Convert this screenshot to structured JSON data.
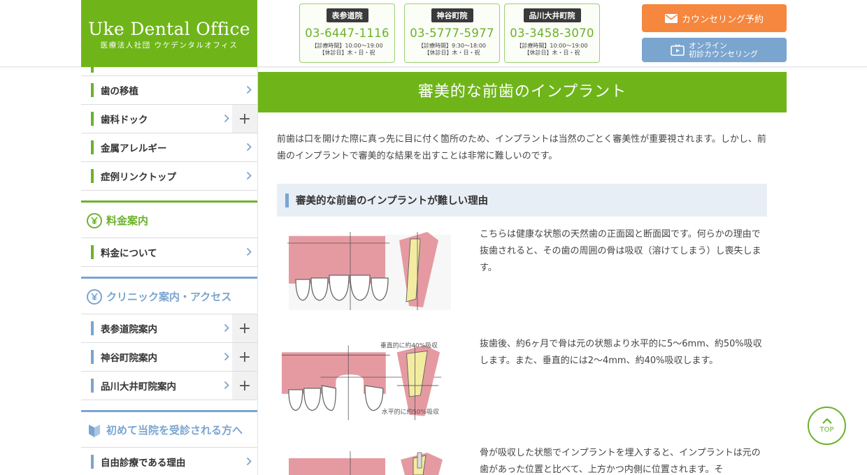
{
  "header": {
    "logo_title": "Uke Dental Office",
    "logo_subtitle": "医療法人社団 ウケデンタルオフィス",
    "clinics": [
      {
        "name": "表参道院",
        "tel": "03-6447-1116",
        "hours": "【診療時間】10:00〜19:00",
        "closed": "【休診日】木・日・祝"
      },
      {
        "name": "神谷町院",
        "tel": "03-5777-5977",
        "hours": "【診療時間】9:30〜18:00",
        "closed": "【休診日】木・日・祝"
      },
      {
        "name": "品川大井町院",
        "tel": "03-3458-3070",
        "hours": "【診療時間】10:00〜19:00",
        "closed": "【休診日】木・日・祝"
      }
    ],
    "counseling_button": "カウンセリング予約",
    "online_button": "オンライン\n初診カウンセリング"
  },
  "sidebar": {
    "items_top": [
      {
        "label": "歯の移植",
        "plus": false
      },
      {
        "label": "歯科ドック",
        "plus": true
      },
      {
        "label": "金属アレルギー",
        "plus": false
      },
      {
        "label": "症例リンクトップ",
        "plus": false
      }
    ],
    "fee_section": {
      "title": "料金案内",
      "items": [
        {
          "label": "料金について"
        }
      ]
    },
    "clinic_section": {
      "title": "クリニック案内・アクセス",
      "items": [
        {
          "label": "表参道院案内"
        },
        {
          "label": "神谷町院案内"
        },
        {
          "label": "品川大井町院案内"
        }
      ]
    },
    "first_visit_section": {
      "title": "初めて当院を受診される方へ",
      "items": [
        {
          "label": "自由診療である理由"
        }
      ]
    }
  },
  "main": {
    "page_title": "審美的な前歯のインプラント",
    "intro": "前歯は口を開けた際に真っ先に目に付く箇所のため、インプラントは当然のごとく審美性が重要視されます。しかし、前歯のインプラントで審美的な結果を出すことは非常に難しいのです。",
    "sub_heading": "審美的な前歯のインプラントが難しい理由",
    "figures": [
      {
        "text": "こちらは健康な状態の天然歯の正面図と断面図です。何らかの理由で抜歯されると、その歯の周囲の骨は吸収（溶けてしまう）し喪失します。"
      },
      {
        "text": "抜歯後、約6ヶ月で骨は元の状態より水平的に5〜6mm、約50%吸収します。また、垂直的には2〜4mm、約40%吸収します。",
        "label_vertical": "垂直的に約40%吸収",
        "label_horizontal": "水平的に約50%吸収"
      },
      {
        "text": "骨が吸収した状態でインプラントを埋入すると、インプラントは元の歯があった位置と比べて、上方かつ内側に位置されます。そ"
      }
    ]
  },
  "top_button": "TOP",
  "colors": {
    "green": "#6fb51a",
    "blue": "#7aa5cf",
    "orange": "#f5873e",
    "gum": "#e59aa1"
  }
}
